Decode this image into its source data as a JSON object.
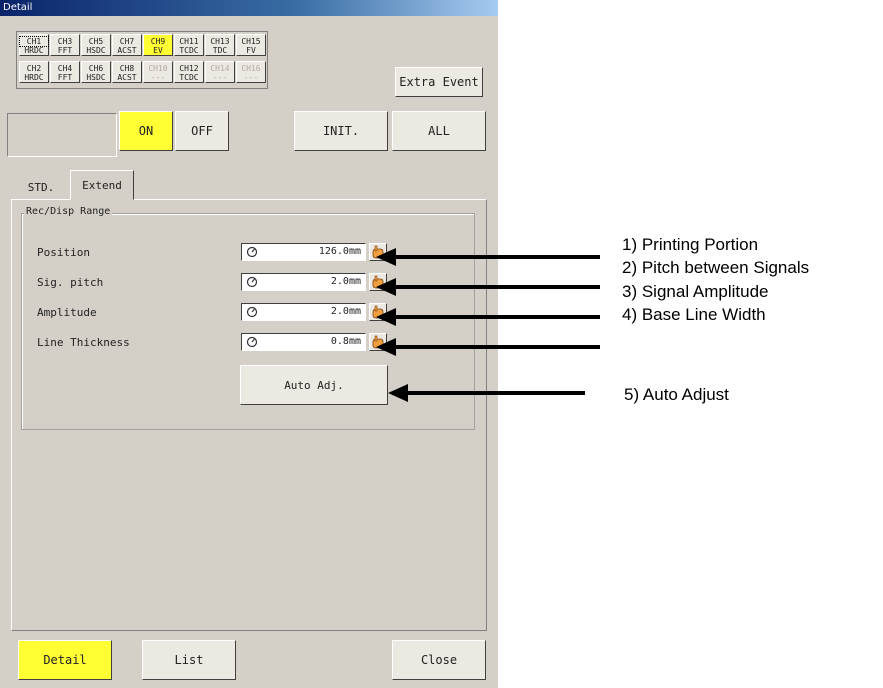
{
  "window": {
    "title": "Detail"
  },
  "channels": [
    {
      "ch": "CH1",
      "type": "HRDC",
      "state": "focus"
    },
    {
      "ch": "CH3",
      "type": "FFT",
      "state": "normal"
    },
    {
      "ch": "CH5",
      "type": "HSDC",
      "state": "normal"
    },
    {
      "ch": "CH7",
      "type": "ACST",
      "state": "normal"
    },
    {
      "ch": "CH9",
      "type": "EV",
      "state": "selected"
    },
    {
      "ch": "CH11",
      "type": "TCDC",
      "state": "normal"
    },
    {
      "ch": "CH13",
      "type": "TDC",
      "state": "normal"
    },
    {
      "ch": "CH15",
      "type": "FV",
      "state": "normal"
    },
    {
      "ch": "CH2",
      "type": "HRDC",
      "state": "normal"
    },
    {
      "ch": "CH4",
      "type": "FFT",
      "state": "normal"
    },
    {
      "ch": "CH6",
      "type": "HSDC",
      "state": "normal"
    },
    {
      "ch": "CH8",
      "type": "ACST",
      "state": "normal"
    },
    {
      "ch": "CH10",
      "type": "---",
      "state": "disabled"
    },
    {
      "ch": "CH12",
      "type": "TCDC",
      "state": "normal"
    },
    {
      "ch": "CH14",
      "type": "---",
      "state": "disabled"
    },
    {
      "ch": "CH16",
      "type": "---",
      "state": "disabled"
    }
  ],
  "buttons": {
    "extra_event": "Extra Event",
    "on": "ON",
    "off": "OFF",
    "init": "INIT.",
    "all": "ALL",
    "auto_adj": "Auto Adj.",
    "detail": "Detail",
    "list": "List",
    "close": "Close"
  },
  "tabs": {
    "std": "STD.",
    "extend": "Extend"
  },
  "group": {
    "label": "Rec/Disp Range"
  },
  "rows": [
    {
      "label": "Position",
      "value": "126.0mm"
    },
    {
      "label": "Sig. pitch",
      "value": "2.0mm"
    },
    {
      "label": "Amplitude",
      "value": "2.0mm"
    },
    {
      "label": "Line Thickness",
      "value": "0.8mm"
    }
  ],
  "callouts": [
    "1) Printing Portion",
    "2) Pitch between Signals",
    "3) Signal Amplitude",
    "4) Base Line Width",
    "5) Auto Adjust"
  ],
  "icons": {
    "knob": "dial-icon",
    "hand": "hand-pointer-icon"
  },
  "colors": {
    "highlight": "#ffff33",
    "face": "#d4d0c8"
  }
}
